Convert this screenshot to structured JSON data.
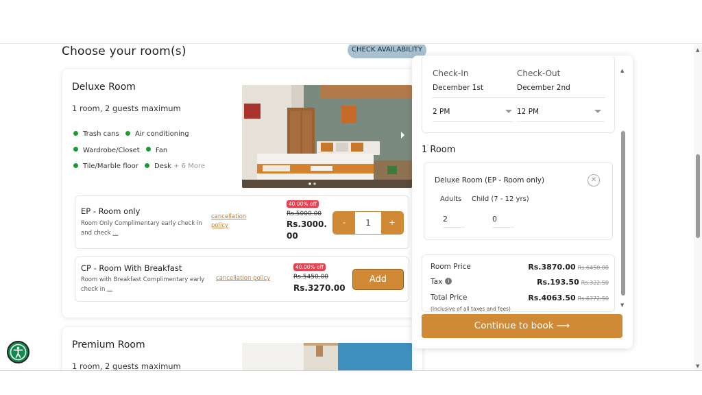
{
  "header": {
    "section_title": "Choose your room(s)",
    "check_availability_label": "CHECK AVAILABILITY"
  },
  "rooms": [
    {
      "name": "Deluxe Room",
      "capacity": "1 room, 2 guests maximum",
      "amenities": [
        [
          "Trash cans",
          "Air conditioning"
        ],
        [
          "Wardrobe/Closet",
          "Fan"
        ],
        [
          "Tile/Marble floor",
          "Desk"
        ]
      ],
      "more_label": "+ 6 More",
      "rates": [
        {
          "title": "EP - Room only",
          "description": "Room Only Complimentary early check in and check",
          "ellipsis": "...",
          "cancellation_label": "cancellation policy",
          "discount_badge": "40.00% off",
          "original_price": "Rs.5000.00",
          "price": "Rs.3000.00",
          "quantity": "1",
          "minus_label": "-",
          "plus_label": "+"
        },
        {
          "title": "CP - Room With Breakfast",
          "description": "Room with Breakfast Complimentary early check in",
          "ellipsis": "...",
          "cancellation_label": "cancellation policy",
          "discount_badge": "40.00% off",
          "original_price": "Rs.5450.00",
          "price": "Rs.3270.00",
          "add_label": "Add"
        }
      ]
    },
    {
      "name": "Premium Room",
      "capacity": "1 room, 2 guests maximum"
    }
  ],
  "booking": {
    "check_in_label": "Check-In",
    "check_out_label": "Check-Out",
    "check_in_date": "December 1st",
    "check_out_date": "December 2nd",
    "check_in_time": "2 PM",
    "check_out_time": "12 PM",
    "rooms_count": "1 Room",
    "selection_title": "Deluxe Room (EP - Room only)",
    "adults_label": "Adults",
    "child_label": "Child (7 - 12 yrs)",
    "adults_value": "2",
    "child_value": "0",
    "room_price_label": "Room Price",
    "room_price": "Rs.3870.00",
    "room_price_original": "Rs.6450.00",
    "tax_label": "Tax",
    "tax": "Rs.193.50",
    "tax_original": "Rs.322.50",
    "total_label": "Total Price",
    "total": "Rs.4063.50",
    "total_original": "Rs.6772.50",
    "total_note": "(Inclusive of all taxes and fees)",
    "continue_label": "Continue to book ⟶"
  },
  "colors": {
    "accent": "#d08a36",
    "badge": "#e8414f",
    "amenity_dot": "#1a9b34",
    "check_availability_bg": "#a7c1d3",
    "accessibility": "#108a4a"
  },
  "icons": [
    "close-icon",
    "info-icon",
    "accessibility-icon",
    "arrow-right-icon",
    "chevron-down-icon",
    "chevron-right-icon"
  ]
}
